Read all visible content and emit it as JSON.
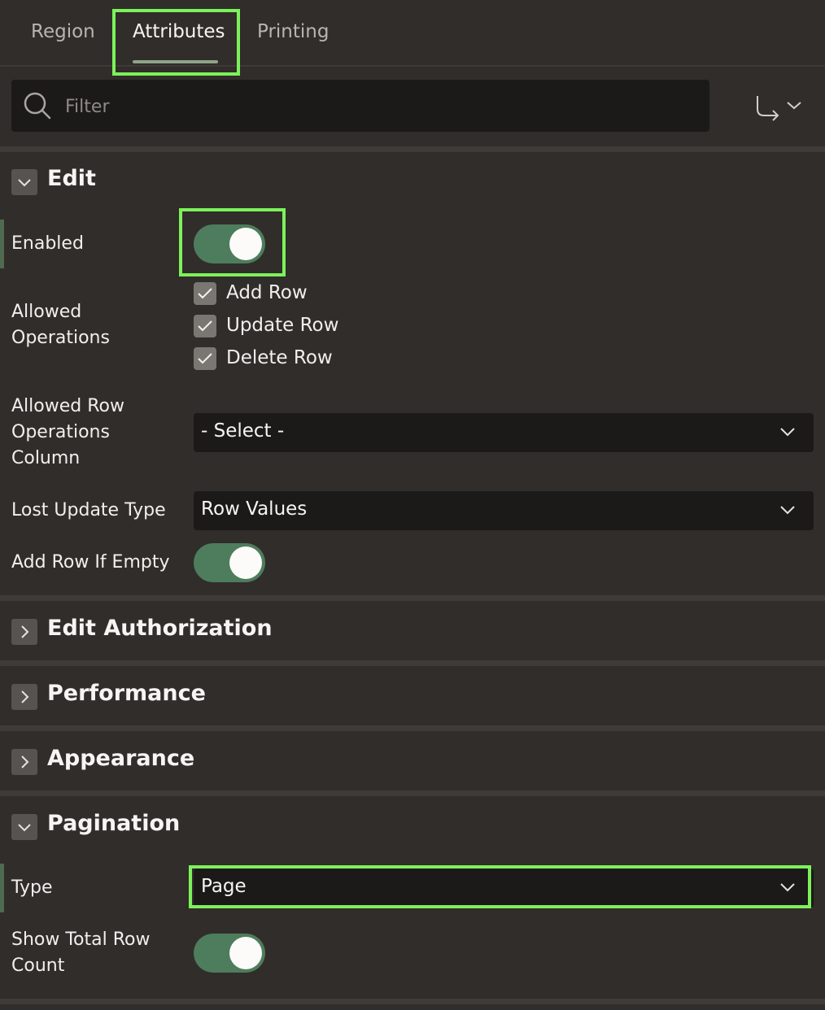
{
  "tabs": [
    {
      "label": "Region"
    },
    {
      "label": "Attributes"
    },
    {
      "label": "Printing"
    }
  ],
  "filter": {
    "placeholder": "Filter"
  },
  "sections": {
    "edit": {
      "title": "Edit",
      "enabled_label": "Enabled",
      "enabled_value": true,
      "allowed_operations_label": "Allowed Operations",
      "operations": [
        {
          "label": "Add Row",
          "checked": true
        },
        {
          "label": "Update Row",
          "checked": true
        },
        {
          "label": "Delete Row",
          "checked": true
        }
      ],
      "allowed_row_ops_label": "Allowed Row Operations Column",
      "allowed_row_ops_value": "- Select -",
      "lost_update_label": "Lost Update Type",
      "lost_update_value": "Row Values",
      "add_row_if_empty_label": "Add Row If Empty",
      "add_row_if_empty_value": true
    },
    "edit_authorization": {
      "title": "Edit Authorization"
    },
    "performance": {
      "title": "Performance"
    },
    "appearance": {
      "title": "Appearance"
    },
    "pagination": {
      "title": "Pagination",
      "type_label": "Type",
      "type_value": "Page",
      "show_total_label": "Show Total Row Count",
      "show_total_value": true
    }
  },
  "colors": {
    "background": "#312d2a",
    "toggle_on": "#4d7d5c",
    "highlight": "#7cf25a",
    "field_bg": "#1c1a19"
  }
}
